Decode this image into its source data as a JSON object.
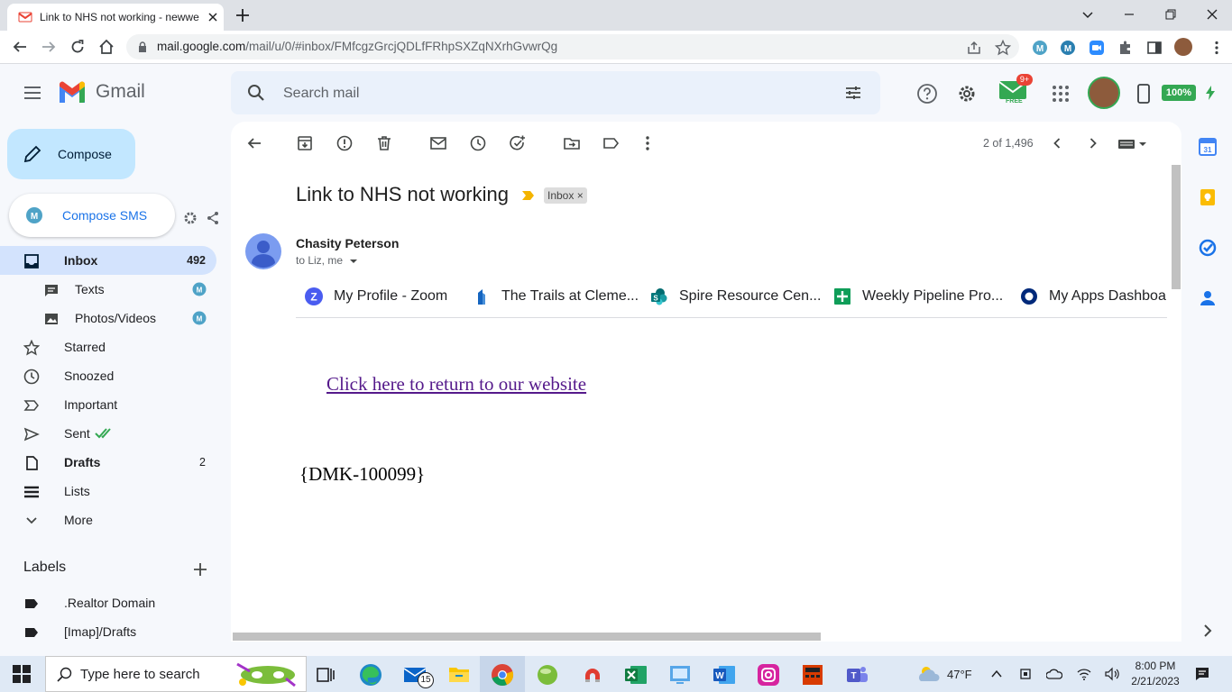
{
  "browser": {
    "tab_title": "Link to NHS not working - newwe",
    "url_host": "mail.google.com",
    "url_path": "/mail/u/0/#inbox/FMfcgzGrcjQDLfFRhpSXZqNXrhGvwrQg"
  },
  "gmail": {
    "product_name": "Gmail",
    "search_placeholder": "Search mail",
    "battery": "100%",
    "notification_badge": "9+",
    "free_label": "FREE"
  },
  "sidebar": {
    "compose_label": "Compose",
    "compose_sms_label": "Compose SMS",
    "items": [
      {
        "label": "Inbox",
        "count": "492",
        "icon": "inbox-icon"
      },
      {
        "label": "Texts",
        "count": "",
        "icon": "chat-icon"
      },
      {
        "label": "Photos/Videos",
        "count": "",
        "icon": "image-icon"
      },
      {
        "label": "Starred",
        "count": "",
        "icon": "star-icon"
      },
      {
        "label": "Snoozed",
        "count": "",
        "icon": "clock-icon"
      },
      {
        "label": "Important",
        "count": "",
        "icon": "important-icon"
      },
      {
        "label": "Sent",
        "count": "",
        "icon": "send-icon"
      },
      {
        "label": "Drafts",
        "count": "2",
        "icon": "draft-icon"
      },
      {
        "label": "Lists",
        "count": "",
        "icon": "list-icon"
      },
      {
        "label": "More",
        "count": "",
        "icon": "chevron-down-icon"
      }
    ],
    "labels_heading": "Labels",
    "labels": [
      {
        "label": ".Realtor Domain"
      },
      {
        "label": "[Imap]/Drafts"
      }
    ]
  },
  "message": {
    "pager": "2 of 1,496",
    "subject": "Link to NHS not working",
    "inbox_chip": "Inbox ×",
    "sender": "Chasity Peterson",
    "recipients": "to Liz, me",
    "bookmarks": [
      {
        "label": "My Profile - Zoom",
        "icon": "zoom-icon",
        "color": "#2d8cff"
      },
      {
        "label": "The Trails at Cleme...",
        "icon": "building-icon",
        "color": "#1565c0"
      },
      {
        "label": "Spire Resource Cen...",
        "icon": "sharepoint-icon",
        "color": "#038387"
      },
      {
        "label": "Weekly Pipeline Pro...",
        "icon": "sheets-icon",
        "color": "#0f9d58"
      },
      {
        "label": "My Apps Dashboa",
        "icon": "okta-icon",
        "color": "#00297a"
      }
    ],
    "body_link": "Click here to return to our website",
    "body_code": "{DMK-100099}"
  },
  "taskbar": {
    "search_text": "Type here to search",
    "temperature": "47°F",
    "mail_badge": "15",
    "time": "8:00 PM",
    "date": "2/21/2023"
  },
  "colors": {
    "accent": "#0b57d0",
    "compose_bg": "#c2e7ff",
    "active_nav": "#d3e3fd",
    "link_visited": "#551a8b"
  }
}
